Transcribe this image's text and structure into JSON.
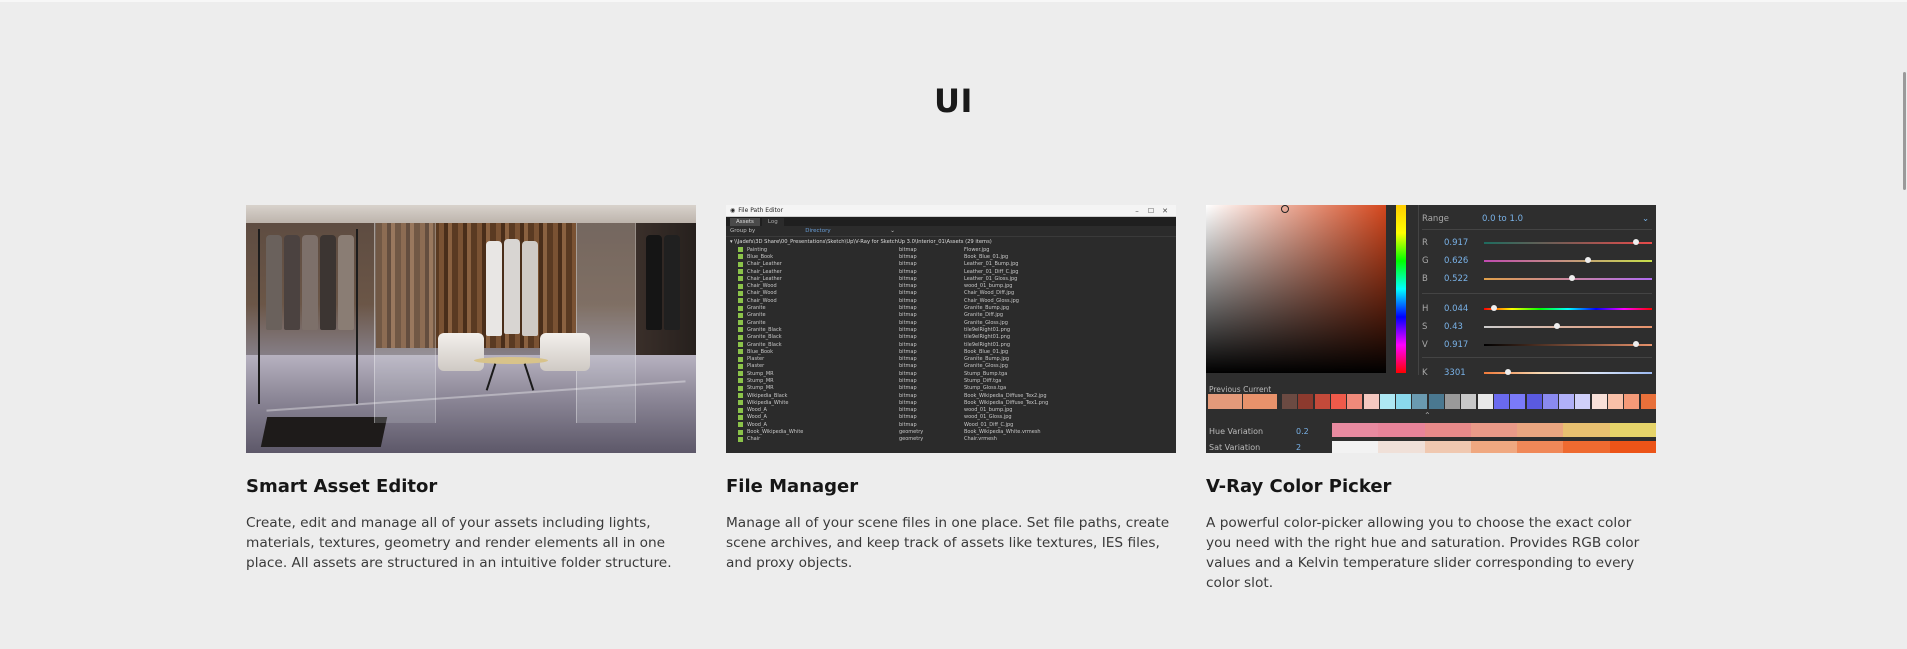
{
  "section": {
    "title": "UI"
  },
  "cards": [
    {
      "title": "Smart Asset Editor",
      "description": "Create, edit and manage all of your assets including lights, materials, textures, geometry and render elements all in one place. All assets are structured in an intuitive folder structure."
    },
    {
      "title": "File Manager",
      "description": "Manage all of your scene files in one place. Set file paths, create scene archives, and keep track of assets like textures, IES files, and proxy objects."
    },
    {
      "title": "V-Ray Color Picker",
      "description": "A powerful color-picker allowing you to choose the exact color you need with the right hue and saturation. Provides RGB color values and a Kelvin temperature slider corresponding to every color slot."
    }
  ],
  "file_manager": {
    "window_title": "File Path Editor",
    "controls": [
      "–",
      "☐",
      "✕"
    ],
    "tabs": [
      "Assets",
      "Log"
    ],
    "group_by_label": "Group by",
    "group_by_value": "Directory",
    "path": "\\\\Jadefs\\3D Share\\00_Presentations\\Sketch\\Up\\V-Ray for SketchUp 3.0\\Interior_01\\Assets (29 items)",
    "rows": [
      [
        "Painting",
        "bitmap",
        "Flower.jpg"
      ],
      [
        "Blue_Book",
        "bitmap",
        "Book_Blue_01.jpg"
      ],
      [
        "Chair_Leather",
        "bitmap",
        "Leather_01_Bump.jpg"
      ],
      [
        "Chair_Leather",
        "bitmap",
        "Leather_01_Diff_C.jpg"
      ],
      [
        "Chair_Leather",
        "bitmap",
        "Leather_01_Gloss.jpg"
      ],
      [
        "Chair_Wood",
        "bitmap",
        "wood_01_bump.jpg"
      ],
      [
        "Chair_Wood",
        "bitmap",
        "Chair_Wood_Diff.jpg"
      ],
      [
        "Chair_Wood",
        "bitmap",
        "Chair_Wood_Gloss.jpg"
      ],
      [
        "Granite",
        "bitmap",
        "Granite_Bump.jpg"
      ],
      [
        "Granite",
        "bitmap",
        "Granite_Diff.jpg"
      ],
      [
        "Granite",
        "bitmap",
        "Granite_Gloss.jpg"
      ],
      [
        "Granite_Black",
        "bitmap",
        "tile9elRight01.png"
      ],
      [
        "Granite_Black",
        "bitmap",
        "tile9elRight01.png"
      ],
      [
        "Granite_Black",
        "bitmap",
        "tile9elRight01.png"
      ],
      [
        "Blue_Book",
        "bitmap",
        "Book_Blue_01.jpg"
      ],
      [
        "Plaster",
        "bitmap",
        "Granite_Bump.jpg"
      ],
      [
        "Plaster",
        "bitmap",
        "Granite_Gloss.jpg"
      ],
      [
        "Stump_MR",
        "bitmap",
        "Stump_Bump.tga"
      ],
      [
        "Stump_MR",
        "bitmap",
        "Stump_Diff.tga"
      ],
      [
        "Stump_MR",
        "bitmap",
        "Stump_Gloss.tga"
      ],
      [
        "Wikipedia_Black",
        "bitmap",
        "Book_Wikipedia_Diffuse_Tex2.jpg"
      ],
      [
        "Wikipedia_White",
        "bitmap",
        "Book_Wikipedia_Diffuse_Tex1.png"
      ],
      [
        "Wood_A",
        "bitmap",
        "wood_01_bump.jpg"
      ],
      [
        "Wood_A",
        "bitmap",
        "wood_01_Gloss.jpg"
      ],
      [
        "Wood_A",
        "bitmap",
        "Wood_01_Diff_C.jpg"
      ],
      [
        "Book_Wikipedia_White",
        "geometry",
        "Book_Wikipedia_White.vrmesh"
      ],
      [
        "Chair",
        "geometry",
        "Chair.vrmesh"
      ]
    ]
  },
  "color_picker": {
    "range_label": "Range",
    "range_value": "0.0 to 1.0",
    "channels": [
      {
        "label": "R",
        "value": "0.917",
        "level": 0.917
      },
      {
        "label": "G",
        "value": "0.626",
        "level": 0.626
      },
      {
        "label": "B",
        "value": "0.522",
        "level": 0.522
      },
      {
        "label": "H",
        "value": "0.044",
        "level": 0.044
      },
      {
        "label": "S",
        "value": "0.43",
        "level": 0.43
      },
      {
        "label": "V",
        "value": "0.917",
        "level": 0.917
      },
      {
        "label": "K",
        "value": "3301",
        "level": 0.13
      }
    ],
    "previous_current_label": "Previous  Current",
    "previous_color": "#e49a7a",
    "current_color": "#e8926b",
    "swatches": [
      "#6b4a42",
      "#8c3a2e",
      "#c44a3a",
      "#ee5a4a",
      "#f08a7a",
      "#f4c8c0",
      "#aee8f4",
      "#8ad8ec",
      "#6a9ab0",
      "#4a7890",
      "#9a9a9a",
      "#c8c8c8",
      "#e8e8e8",
      "#6a6aee",
      "#7a7af8",
      "#5a5ae0",
      "#8a8af0",
      "#b0b0f8",
      "#d0d0fa",
      "#f8e0d8",
      "#f8c0a8",
      "#f49a78",
      "#e8703a"
    ],
    "hue_variation_label": "Hue Variation",
    "hue_variation_value": "0.2",
    "hue_variation_colors": [
      "#e88aa0",
      "#e8849a",
      "#e88a8a",
      "#ea9a88",
      "#eaa680",
      "#e8c070",
      "#e6d46a"
    ],
    "sat_variation_label": "Sat Variation",
    "sat_variation_value": "2",
    "sat_variation_colors": [
      "#f2f2f2",
      "#f0e0d8",
      "#f0c8b0",
      "#f0a880",
      "#f08858",
      "#ee6a30",
      "#ec5418"
    ]
  }
}
